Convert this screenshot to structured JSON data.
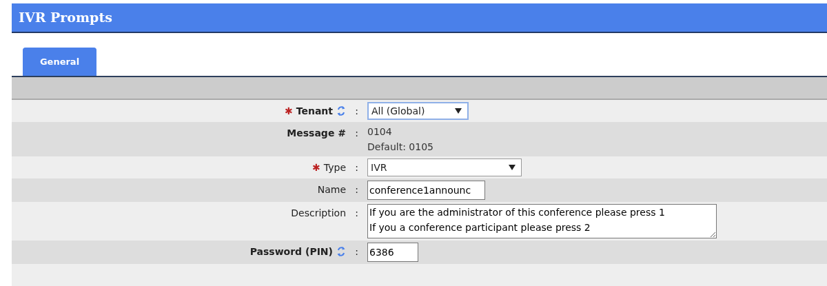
{
  "header": {
    "title": "IVR Prompts"
  },
  "tabs": [
    {
      "label": "General",
      "selected": true
    }
  ],
  "fields": [
    {
      "kind": "select",
      "marker": "✱",
      "label": "Tenant",
      "bold": true,
      "refresh": true,
      "separator": ":",
      "value": "All (Global)"
    },
    {
      "kind": "text",
      "label": "Message #",
      "bold": true,
      "refresh": false,
      "separator": ":",
      "lines": [
        "0104",
        "Default: 0105"
      ]
    },
    {
      "kind": "select",
      "marker": "✱",
      "label": "Type",
      "bold": false,
      "refresh": false,
      "separator": ":",
      "value": "IVR"
    },
    {
      "kind": "input",
      "label": "Name",
      "bold": false,
      "refresh": false,
      "separator": ":",
      "value": "conference1announc"
    },
    {
      "kind": "textarea",
      "label": "Description",
      "bold": false,
      "refresh": false,
      "separator": ":",
      "lines": [
        "If you are the administrator of this conference please press 1",
        "If you a conference participant please press 2"
      ]
    },
    {
      "kind": "input",
      "label": "Password (PIN)",
      "bold": true,
      "refresh": true,
      "separator": ":",
      "value": "6386"
    }
  ]
}
